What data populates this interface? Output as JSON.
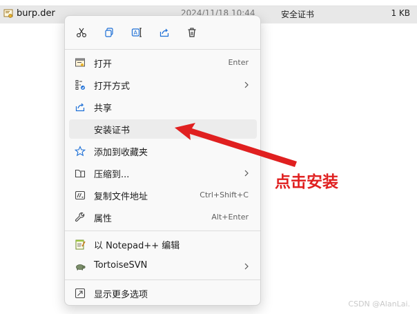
{
  "file_row": {
    "name": "burp.der",
    "date": "2024/11/18 10:44",
    "type": "安全证书",
    "size": "1 KB"
  },
  "toolbar": {
    "icons": [
      "cut-icon",
      "copy-icon",
      "rename-icon",
      "share-icon",
      "delete-icon"
    ]
  },
  "menu": {
    "items": [
      {
        "label": "打开",
        "shortcut": "Enter",
        "icon": "open-file-icon"
      },
      {
        "label": "打开方式",
        "shortcut": "",
        "icon": "open-with-icon",
        "submenu": true
      },
      {
        "label": "共享",
        "shortcut": "",
        "icon": "share-icon"
      },
      {
        "label": "安装证书",
        "shortcut": "",
        "icon": "",
        "hovered": true
      },
      {
        "label": "添加到收藏夹",
        "shortcut": "",
        "icon": "star-icon"
      },
      {
        "label": "压缩到...",
        "shortcut": "",
        "icon": "zip-folder-icon",
        "submenu": true
      },
      {
        "label": "复制文件地址",
        "shortcut": "Ctrl+Shift+C",
        "icon": "copy-path-icon"
      },
      {
        "label": "属性",
        "shortcut": "Alt+Enter",
        "icon": "wrench-icon"
      },
      {
        "label": "以 Notepad++ 编辑",
        "shortcut": "",
        "icon": "notepad-plus-plus-icon"
      },
      {
        "label": "TortoiseSVN",
        "shortcut": "",
        "icon": "tortoise-icon",
        "submenu": true
      },
      {
        "label": "显示更多选项",
        "shortcut": "",
        "icon": "more-options-icon"
      }
    ]
  },
  "annotation": {
    "text": "点击安装",
    "color": "#e02020"
  },
  "watermark": "CSDN @AlanLai."
}
